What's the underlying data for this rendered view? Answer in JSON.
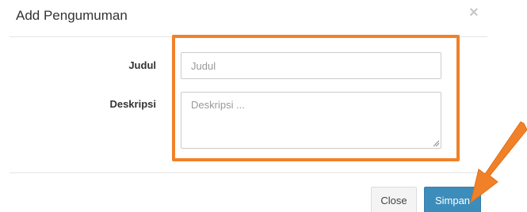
{
  "modal": {
    "title": "Add Pengumuman",
    "close_symbol": "×"
  },
  "form": {
    "judul": {
      "label": "Judul",
      "placeholder": "Judul",
      "value": ""
    },
    "deskripsi": {
      "label": "Deskripsi",
      "placeholder": "Deskripsi ...",
      "value": ""
    }
  },
  "footer": {
    "close_label": "Close",
    "save_label": "Simpan"
  },
  "annotation": {
    "color": "#f08128",
    "icons": [
      "highlight-box",
      "arrow-icon"
    ]
  },
  "colors": {
    "primary": "#3c8dbc",
    "default_button": "#f4f4f4",
    "border": "#cccccc"
  }
}
